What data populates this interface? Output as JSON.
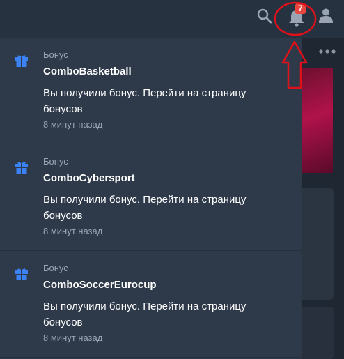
{
  "header": {
    "icons": [
      "search-icon",
      "bell-icon",
      "user-icon"
    ],
    "notification_count": "7"
  },
  "sidebar_more_icon": "more-horizontal-icon",
  "notifications": [
    {
      "category": "Бонус",
      "title": "ComboBasketball",
      "message": "Вы получили бонус. Перейти на страницу бонусов",
      "time": "8 минут назад",
      "icon": "gift-icon"
    },
    {
      "category": "Бонус",
      "title": "ComboCybersport",
      "message": "Вы получили бонус. Перейти на страницу бонусов",
      "time": "8 минут назад",
      "icon": "gift-icon"
    },
    {
      "category": "Бонус",
      "title": "ComboSoccerEurocup",
      "message": "Вы получили бонус. Перейти на страницу бонусов",
      "time": "8 минут назад",
      "icon": "gift-icon"
    }
  ],
  "colors": {
    "header_bg": "#273240",
    "panel_bg": "#2e3a4a",
    "accent_blue": "#3b82f6",
    "badge_red": "#e8463e",
    "annotation_red": "#e0101a"
  }
}
